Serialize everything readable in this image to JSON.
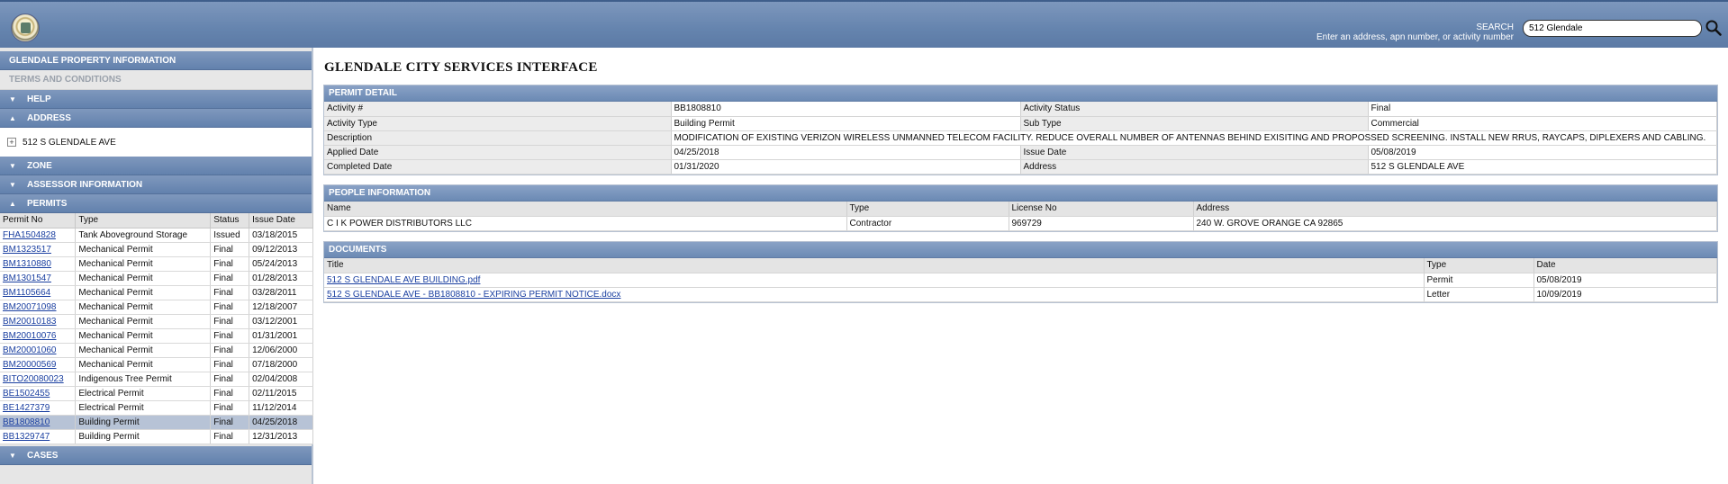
{
  "header": {
    "search_label": "SEARCH",
    "search_hint": "Enter an address, apn number, or activity number",
    "search_value": "512 Glendale"
  },
  "sidebar": {
    "property_info": "GLENDALE PROPERTY INFORMATION",
    "terms": "TERMS AND CONDITIONS",
    "help": "HELP",
    "address": "ADDRESS",
    "address_value": "512 S GLENDALE AVE",
    "zone": "ZONE",
    "assessor": "ASSESSOR INFORMATION",
    "permits": "PERMITS",
    "cases": "CASES",
    "permit_columns": [
      "Permit No",
      "Type",
      "Status",
      "Issue Date"
    ],
    "permit_rows": [
      {
        "no": "FHA1504828",
        "type": "Tank Aboveground Storage",
        "status": "Issued",
        "date": "03/18/2015"
      },
      {
        "no": "BM1323517",
        "type": "Mechanical Permit",
        "status": "Final",
        "date": "09/12/2013"
      },
      {
        "no": "BM1310880",
        "type": "Mechanical Permit",
        "status": "Final",
        "date": "05/24/2013"
      },
      {
        "no": "BM1301547",
        "type": "Mechanical Permit",
        "status": "Final",
        "date": "01/28/2013"
      },
      {
        "no": "BM1105664",
        "type": "Mechanical Permit",
        "status": "Final",
        "date": "03/28/2011"
      },
      {
        "no": "BM20071098",
        "type": "Mechanical Permit",
        "status": "Final",
        "date": "12/18/2007"
      },
      {
        "no": "BM20010183",
        "type": "Mechanical Permit",
        "status": "Final",
        "date": "03/12/2001"
      },
      {
        "no": "BM20010076",
        "type": "Mechanical Permit",
        "status": "Final",
        "date": "01/31/2001"
      },
      {
        "no": "BM20001060",
        "type": "Mechanical Permit",
        "status": "Final",
        "date": "12/06/2000"
      },
      {
        "no": "BM20000569",
        "type": "Mechanical Permit",
        "status": "Final",
        "date": "07/18/2000"
      },
      {
        "no": "BITO20080023",
        "type": "Indigenous Tree Permit",
        "status": "Final",
        "date": "02/04/2008"
      },
      {
        "no": "BE1502455",
        "type": "Electrical Permit",
        "status": "Final",
        "date": "02/11/2015"
      },
      {
        "no": "BE1427379",
        "type": "Electrical Permit",
        "status": "Final",
        "date": "11/12/2014"
      },
      {
        "no": "BB1808810",
        "type": "Building Permit",
        "status": "Final",
        "date": "04/25/2018"
      },
      {
        "no": "BB1329747",
        "type": "Building Permit",
        "status": "Final",
        "date": "12/31/2013"
      }
    ]
  },
  "main": {
    "title": "GLENDALE CITY SERVICES INTERFACE",
    "permit_detail": {
      "heading": "PERMIT DETAIL",
      "activity_no_label": "Activity #",
      "activity_no": "BB1808810",
      "activity_status_label": "Activity Status",
      "activity_status": "Final",
      "activity_type_label": "Activity Type",
      "activity_type": "Building Permit",
      "sub_type_label": "Sub Type",
      "sub_type": "Commercial",
      "description_label": "Description",
      "description": "MODIFICATION OF EXISTING VERIZON WIRELESS UNMANNED TELECOM FACILITY. REDUCE OVERALL NUMBER OF ANTENNAS BEHIND EXISITING AND PROPOSSED SCREENING. INSTALL NEW RRUS, RAYCAPS, DIPLEXERS AND CABLING.",
      "applied_date_label": "Applied Date",
      "applied_date": "04/25/2018",
      "issue_date_label": "Issue Date",
      "issue_date": "05/08/2019",
      "completed_date_label": "Completed Date",
      "completed_date": "01/31/2020",
      "address_label": "Address",
      "address": "512 S GLENDALE AVE"
    },
    "people": {
      "heading": "PEOPLE INFORMATION",
      "columns": [
        "Name",
        "Type",
        "License No",
        "Address"
      ],
      "rows": [
        {
          "name": "C I K POWER DISTRIBUTORS LLC",
          "type": "Contractor",
          "license": "969729",
          "address": "240 W. GROVE ORANGE CA 92865"
        }
      ]
    },
    "documents": {
      "heading": "DOCUMENTS",
      "columns": [
        "Title",
        "Type",
        "Date"
      ],
      "rows": [
        {
          "title": "512 S GLENDALE AVE BUILDING.pdf",
          "type": "Permit",
          "date": "05/08/2019"
        },
        {
          "title": "512 S GLENDALE AVE - BB1808810 - EXPIRING PERMIT NOTICE.docx",
          "type": "Letter",
          "date": "10/09/2019"
        }
      ]
    }
  }
}
